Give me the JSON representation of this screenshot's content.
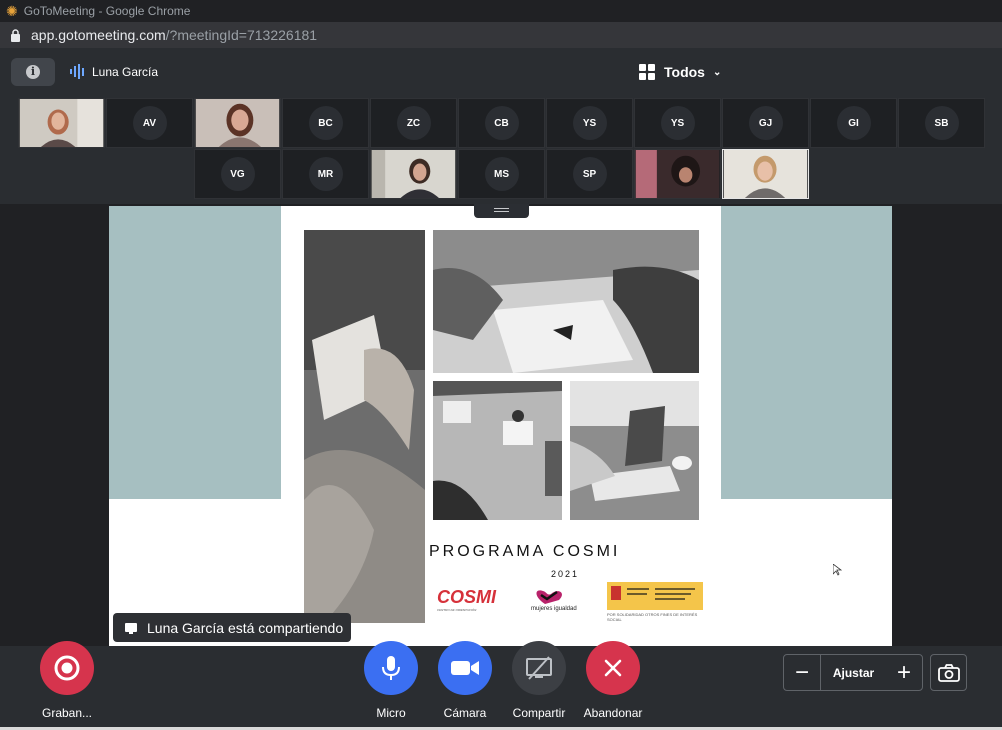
{
  "browser": {
    "window_title": "GoToMeeting - Google Chrome",
    "url_host": "app.gotomeeting.com",
    "url_path": "/?meetingId=713226181"
  },
  "toolbar": {
    "info_icon_glyph": "i",
    "active_speaker": "Luna García",
    "view_label": "Todos"
  },
  "participants": {
    "row1": [
      {
        "type": "video"
      },
      {
        "type": "initials",
        "initials": "AV"
      },
      {
        "type": "video"
      },
      {
        "type": "initials",
        "initials": "BC"
      },
      {
        "type": "initials",
        "initials": "ZC"
      },
      {
        "type": "initials",
        "initials": "CB"
      },
      {
        "type": "initials",
        "initials": "YS"
      },
      {
        "type": "initials",
        "initials": "YS"
      },
      {
        "type": "initials",
        "initials": "GJ"
      },
      {
        "type": "initials",
        "initials": "GI"
      },
      {
        "type": "initials",
        "initials": "SB"
      }
    ],
    "row2": [
      {
        "type": "initials",
        "initials": "VG"
      },
      {
        "type": "initials",
        "initials": "MR"
      },
      {
        "type": "video"
      },
      {
        "type": "initials",
        "initials": "MS"
      },
      {
        "type": "initials",
        "initials": "SP"
      },
      {
        "type": "video"
      },
      {
        "type": "video"
      }
    ]
  },
  "slide": {
    "title": "PROGRAMA COSMI",
    "year": "2021",
    "logo_cosmi": "COSMI",
    "logo_cosmi_sub": "CENTRO DE ORIENTACIÓN",
    "logo_mi": "mujeres igualdad",
    "logo_gov_note": "POR SOLIDARIDAD OTROS FINES DE INTERÉS SOCIAL",
    "colors": {
      "teal": "#a6bfc1",
      "cosmi_red": "#d6313a",
      "gov_yellow": "#f4c54a"
    }
  },
  "sharing_banner": "Luna García está compartiendo",
  "controls": {
    "record": {
      "label": "Graban...",
      "color": "#d6344d",
      "icon": "record-icon"
    },
    "mic": {
      "label": "Micro",
      "color": "#3b6ff2",
      "icon": "microphone-icon"
    },
    "camera": {
      "label": "Cámara",
      "color": "#3b6ff2",
      "icon": "video-camera-icon"
    },
    "share": {
      "label": "Compartir",
      "color": "#3c3f44",
      "icon": "screen-share-icon"
    },
    "leave": {
      "label": "Abandonar",
      "color": "#d6344d",
      "icon": "close-icon"
    }
  },
  "zoom": {
    "minus": "−",
    "fit": "Ajustar",
    "plus": "+"
  }
}
